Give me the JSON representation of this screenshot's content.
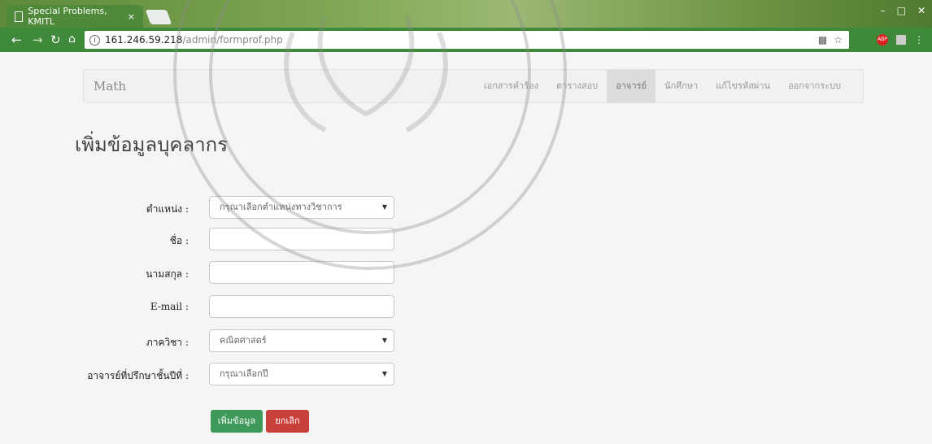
{
  "browser": {
    "tab_title": "Special Problems, KMITL",
    "tab_close": "×",
    "url_host": "161.246.59.218",
    "url_path": "/admin/formprof.php",
    "abp_label": "ABP"
  },
  "navbar": {
    "brand": "Math",
    "links": [
      {
        "label": "เอกสารคำร้อง",
        "active": false
      },
      {
        "label": "ตารางสอบ",
        "active": false
      },
      {
        "label": "อาจารย์",
        "active": true
      },
      {
        "label": "นักศึกษา",
        "active": false
      },
      {
        "label": "แก้ไขรหัสผ่าน",
        "active": false
      },
      {
        "label": "ออกจากระบบ",
        "active": false
      }
    ]
  },
  "page": {
    "heading": "เพิ่มข้อมูลบุคลากร"
  },
  "form": {
    "position_label": "ตำแหน่ง :",
    "position_value": "กรุณาเลือกตำแหน่งทางวิชาการ",
    "firstname_label": "ชื่อ :",
    "firstname_value": "",
    "lastname_label": "นามสกุล :",
    "lastname_value": "",
    "email_label": "E-mail :",
    "email_value": "",
    "department_label": "ภาควิชา :",
    "department_value": "คณิตศาสตร์",
    "advisor_label": "อาจารย์ที่ปรึกษาชั้นปีที่ :",
    "advisor_value": "กรุณาเลือกปี",
    "submit_label": "เพิ่มข้อมูล",
    "cancel_label": "ยกเลิก"
  },
  "colors": {
    "toolbar": "#3e8a3a",
    "btn_save": "#3d9a5a",
    "btn_cancel": "#c9403b"
  }
}
